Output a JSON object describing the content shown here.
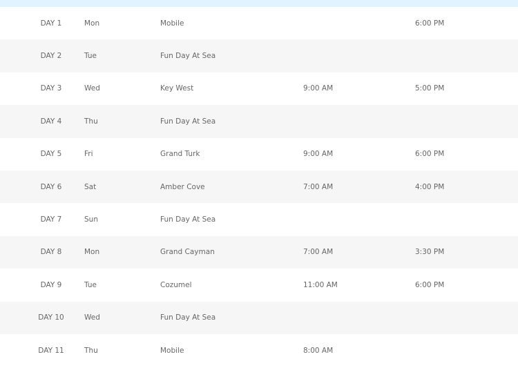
{
  "itinerary": {
    "rows": [
      {
        "day": "DAY 1",
        "weekday": "Mon",
        "port": "Mobile",
        "arrive": "",
        "depart": "6:00 PM"
      },
      {
        "day": "DAY 2",
        "weekday": "Tue",
        "port": "Fun Day At Sea",
        "arrive": "",
        "depart": ""
      },
      {
        "day": "DAY 3",
        "weekday": "Wed",
        "port": "Key West",
        "arrive": "9:00 AM",
        "depart": "5:00 PM"
      },
      {
        "day": "DAY 4",
        "weekday": "Thu",
        "port": "Fun Day At Sea",
        "arrive": "",
        "depart": ""
      },
      {
        "day": "DAY 5",
        "weekday": "Fri",
        "port": "Grand Turk",
        "arrive": "9:00 AM",
        "depart": "6:00 PM"
      },
      {
        "day": "DAY 6",
        "weekday": "Sat",
        "port": "Amber Cove",
        "arrive": "7:00 AM",
        "depart": "4:00 PM"
      },
      {
        "day": "DAY 7",
        "weekday": "Sun",
        "port": "Fun Day At Sea",
        "arrive": "",
        "depart": ""
      },
      {
        "day": "DAY 8",
        "weekday": "Mon",
        "port": "Grand Cayman",
        "arrive": "7:00 AM",
        "depart": "3:30 PM"
      },
      {
        "day": "DAY 9",
        "weekday": "Tue",
        "port": "Cozumel",
        "arrive": "11:00 AM",
        "depart": "6:00 PM"
      },
      {
        "day": "DAY 10",
        "weekday": "Wed",
        "port": "Fun Day At Sea",
        "arrive": "",
        "depart": ""
      },
      {
        "day": "DAY 11",
        "weekday": "Thu",
        "port": "Mobile",
        "arrive": "8:00 AM",
        "depart": ""
      }
    ]
  },
  "colors": {
    "top_band": "#dff4fe",
    "row_alt": "#f6f6f6",
    "text": "#666666"
  }
}
